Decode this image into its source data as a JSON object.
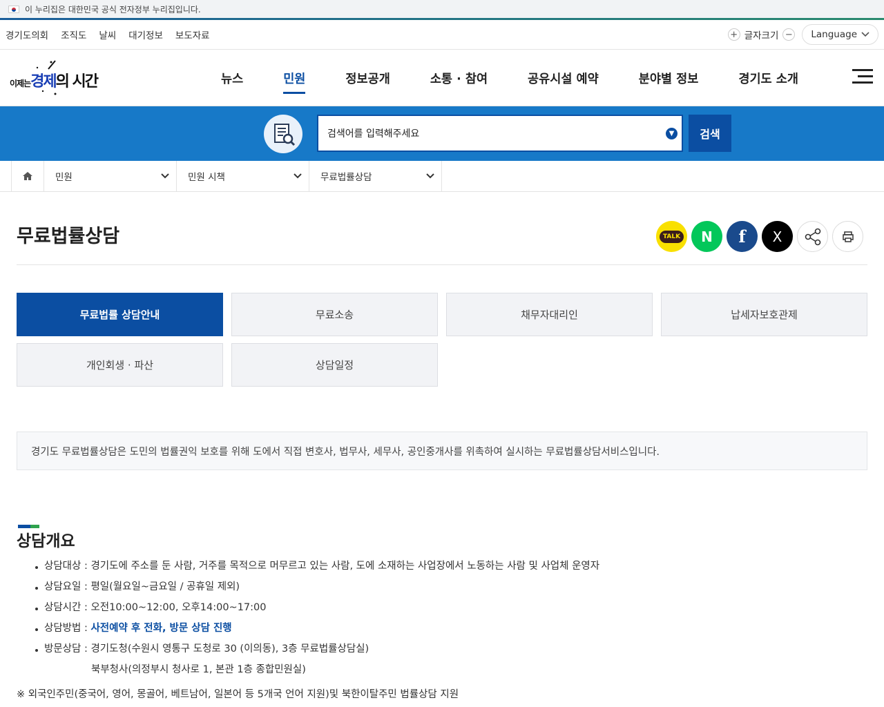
{
  "gov_banner": {
    "text": "이 누리집은 대한민국 공식 전자정부 누리집입니다."
  },
  "utility": {
    "links": [
      "경기도의회",
      "조직도",
      "날씨",
      "대기정보",
      "보도자료"
    ],
    "font_size_label": "글자크기",
    "language_label": "Language"
  },
  "header": {
    "logo": {
      "small": "이제는",
      "blue": "경제",
      "rest": "의 시간"
    },
    "nav": [
      "뉴스",
      "민원",
      "정보공개",
      "소통 · 참여",
      "공유시설 예약",
      "분야별 정보",
      "경기도 소개"
    ],
    "active_nav": "민원"
  },
  "search": {
    "placeholder": "검색어를 입력해주세요",
    "button_label": "검색"
  },
  "breadcrumb": [
    "민원",
    "민원 시책",
    "무료법률상담"
  ],
  "page": {
    "title": "무료법률상담",
    "share_kakao": "TALK",
    "share_naver": "N",
    "share_facebook": "f",
    "share_x": "X"
  },
  "tabs": [
    {
      "label": "무료법률 상담안내",
      "active": true
    },
    {
      "label": "무료소송",
      "active": false
    },
    {
      "label": "채무자대리인",
      "active": false
    },
    {
      "label": "납세자보호관제",
      "active": false
    },
    {
      "label": "개인회생 · 파산",
      "active": false
    },
    {
      "label": "상담일정",
      "active": false
    }
  ],
  "intro": "경기도 무료법률상담은 도민의 법률권익 보호를 위해 도에서 직접 변호사, 법무사, 세무사, 공인중개사를 위촉하여 실시하는 무료법률상담서비스입니다.",
  "overview": {
    "title": "상담개요",
    "items": [
      {
        "label": "상담대상 : ",
        "value": "경기도에 주소를 둔 사람, 거주를 목적으로 머무르고 있는 사람, 도에 소재하는 사업장에서 노동하는 사람 및 사업체 운영자"
      },
      {
        "label": "상담요일 : ",
        "value": "평일(월요일~금요일 / 공휴일 제외)"
      },
      {
        "label": "상담시간 : ",
        "value": "오전10:00~12:00, 오후14:00~17:00"
      },
      {
        "label": "상담방법 : ",
        "value": "사전예약 후 전화, 방문 상담 진행"
      },
      {
        "label": "방문상담 : ",
        "value": "경기도청(수원시 영통구 도청로 30 (이의동), 3층 무료법률상담실)"
      }
    ],
    "visit_continuation": "북부청사(의정부시 청사로 1, 본관 1층 종합민원실)",
    "note": "※ 외국인주민(중국어, 영어, 몽골어, 베트남어, 일본어 등 5개국 언어 지원)및 북한이탈주민 법률상담 지원"
  },
  "colors": {
    "primary": "#0b4ea2",
    "band": "#1779c8",
    "accent_green": "#2fa34e"
  }
}
